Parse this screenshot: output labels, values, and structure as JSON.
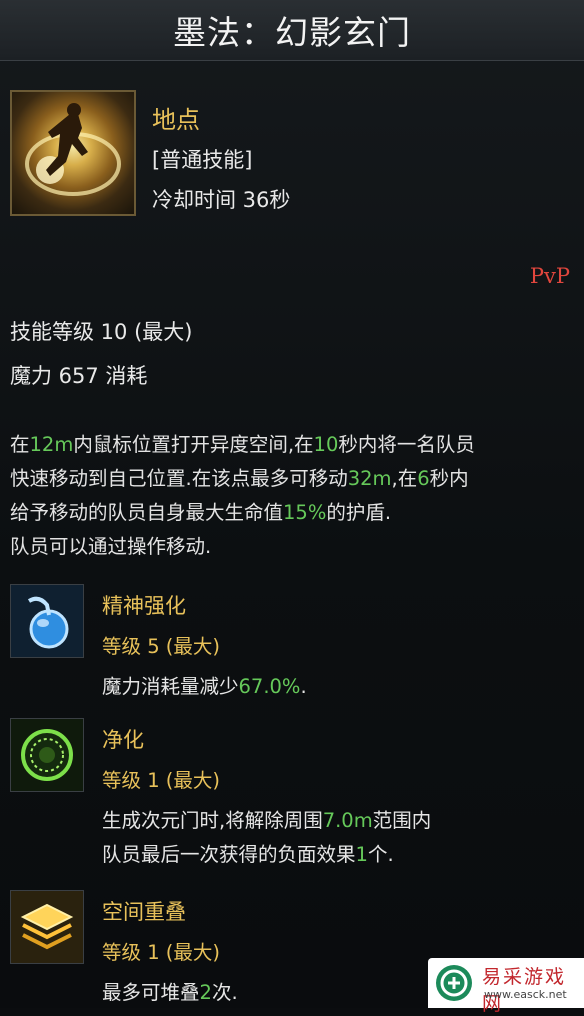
{
  "title": "墨法：幻影玄门",
  "skill": {
    "name": "地点",
    "type": "[普通技能]",
    "cooldown": "冷却时间 36秒",
    "mode": "PvP",
    "level": "技能等级 10 (最大)",
    "mana": "魔力 657 消耗"
  },
  "description": {
    "line1_a": "在",
    "line1_b": "12m",
    "line1_c": "内鼠标位置打开异度空间,在",
    "line1_d": "10",
    "line1_e": "秒内将一名队员",
    "line2_a": "快速移动到自己位置.在该点最多可移动",
    "line2_b": "32m",
    "line2_c": ",在",
    "line2_d": "6",
    "line2_e": "秒内",
    "line3_a": "给予移动的队员自身最大生命值",
    "line3_b": "15%",
    "line3_c": "的护盾.",
    "line4": "队员可以通过操作移动."
  },
  "tripods": [
    {
      "name": "精神强化",
      "level": "等级 5 (最大)",
      "effect_a": "魔力消耗量减少",
      "effect_b": "67.0%",
      "effect_c": "."
    },
    {
      "name": "净化",
      "level": "等级 1 (最大)",
      "effect_a": "生成次元门时,将解除周围",
      "effect_b": "7.0m",
      "effect_c": "范围内",
      "effect2_a": "队员最后一次获得的负面效果",
      "effect2_b": "1",
      "effect2_c": "个."
    },
    {
      "name": "空间重叠",
      "level": "等级 1 (最大)",
      "effect_a": "最多可堆叠",
      "effect_b": "2",
      "effect_c": "次."
    }
  ],
  "watermark": {
    "cn": "易采游戏网",
    "url": "www.easck.net"
  },
  "colors": {
    "accent_gold": "#e8c15a",
    "highlight_green": "#66c95a",
    "pvp_red": "#e0463d"
  },
  "icons": {
    "skill": "portal-caster-icon",
    "tripod1": "mana-potion-icon",
    "tripod2": "purify-ring-icon",
    "tripod3": "stacked-layers-icon"
  }
}
